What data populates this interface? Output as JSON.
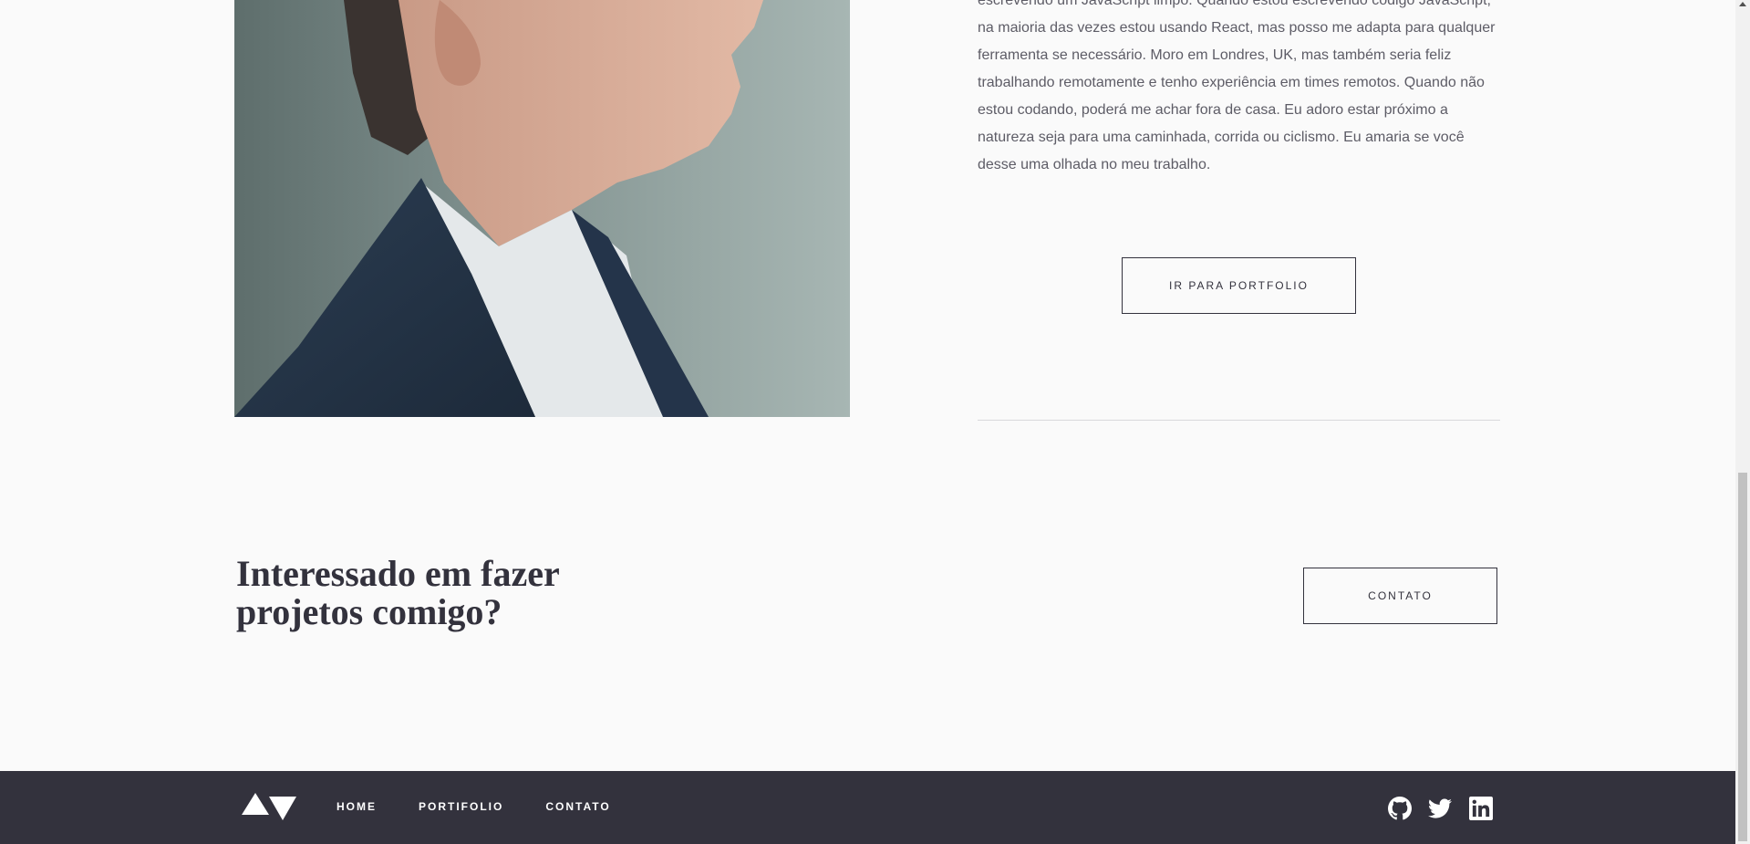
{
  "about": {
    "paragraph": "escrevendo um JavaScript limpo. Quando estou escrevendo código JavaScript, na maioria das vezes estou usando React, mas posso me adapta para qualquer ferramenta se necessário. Moro em Londres, UK, mas também seria feliz trabalhando remotamente e tenho experiência em times remotos. Quando não estou codando, poderá me achar fora de casa. Eu adoro estar próximo a natureza seja para uma caminhada, corrida ou ciclismo. Eu amaria se você desse uma olhada no meu trabalho.",
    "portfolio_button": "IR PARA PORTFOLIO"
  },
  "cta": {
    "title": "Interessado em fazer projetos comigo?",
    "button": "CONTATO"
  },
  "footer": {
    "nav": [
      {
        "label": "HOME"
      },
      {
        "label": "PORTIFOLIO"
      },
      {
        "label": "CONTATO"
      }
    ],
    "social": [
      "github-icon",
      "twitter-icon",
      "linkedin-icon"
    ],
    "logo": "logo-icon"
  },
  "colors": {
    "dark": "#33323d",
    "background": "#fafafa",
    "text": "#5d5c66"
  }
}
